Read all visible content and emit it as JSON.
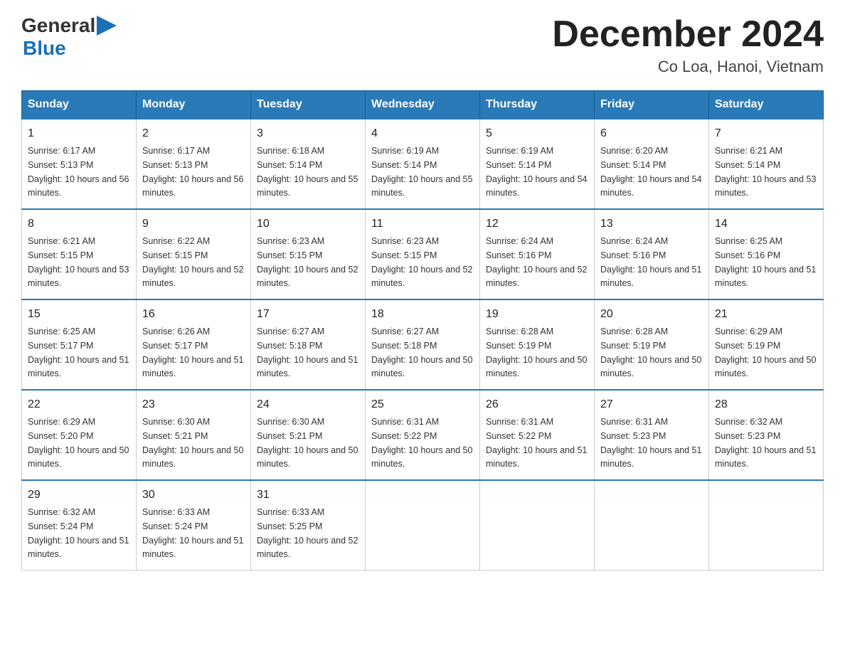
{
  "logo": {
    "text_general": "General",
    "text_blue": "Blue",
    "arrow_color": "#1a6fb5"
  },
  "title": "December 2024",
  "subtitle": "Co Loa, Hanoi, Vietnam",
  "days_of_week": [
    "Sunday",
    "Monday",
    "Tuesday",
    "Wednesday",
    "Thursday",
    "Friday",
    "Saturday"
  ],
  "weeks": [
    [
      {
        "day": "1",
        "sunrise": "6:17 AM",
        "sunset": "5:13 PM",
        "daylight": "10 hours and 56 minutes."
      },
      {
        "day": "2",
        "sunrise": "6:17 AM",
        "sunset": "5:13 PM",
        "daylight": "10 hours and 56 minutes."
      },
      {
        "day": "3",
        "sunrise": "6:18 AM",
        "sunset": "5:14 PM",
        "daylight": "10 hours and 55 minutes."
      },
      {
        "day": "4",
        "sunrise": "6:19 AM",
        "sunset": "5:14 PM",
        "daylight": "10 hours and 55 minutes."
      },
      {
        "day": "5",
        "sunrise": "6:19 AM",
        "sunset": "5:14 PM",
        "daylight": "10 hours and 54 minutes."
      },
      {
        "day": "6",
        "sunrise": "6:20 AM",
        "sunset": "5:14 PM",
        "daylight": "10 hours and 54 minutes."
      },
      {
        "day": "7",
        "sunrise": "6:21 AM",
        "sunset": "5:14 PM",
        "daylight": "10 hours and 53 minutes."
      }
    ],
    [
      {
        "day": "8",
        "sunrise": "6:21 AM",
        "sunset": "5:15 PM",
        "daylight": "10 hours and 53 minutes."
      },
      {
        "day": "9",
        "sunrise": "6:22 AM",
        "sunset": "5:15 PM",
        "daylight": "10 hours and 52 minutes."
      },
      {
        "day": "10",
        "sunrise": "6:23 AM",
        "sunset": "5:15 PM",
        "daylight": "10 hours and 52 minutes."
      },
      {
        "day": "11",
        "sunrise": "6:23 AM",
        "sunset": "5:15 PM",
        "daylight": "10 hours and 52 minutes."
      },
      {
        "day": "12",
        "sunrise": "6:24 AM",
        "sunset": "5:16 PM",
        "daylight": "10 hours and 52 minutes."
      },
      {
        "day": "13",
        "sunrise": "6:24 AM",
        "sunset": "5:16 PM",
        "daylight": "10 hours and 51 minutes."
      },
      {
        "day": "14",
        "sunrise": "6:25 AM",
        "sunset": "5:16 PM",
        "daylight": "10 hours and 51 minutes."
      }
    ],
    [
      {
        "day": "15",
        "sunrise": "6:25 AM",
        "sunset": "5:17 PM",
        "daylight": "10 hours and 51 minutes."
      },
      {
        "day": "16",
        "sunrise": "6:26 AM",
        "sunset": "5:17 PM",
        "daylight": "10 hours and 51 minutes."
      },
      {
        "day": "17",
        "sunrise": "6:27 AM",
        "sunset": "5:18 PM",
        "daylight": "10 hours and 51 minutes."
      },
      {
        "day": "18",
        "sunrise": "6:27 AM",
        "sunset": "5:18 PM",
        "daylight": "10 hours and 50 minutes."
      },
      {
        "day": "19",
        "sunrise": "6:28 AM",
        "sunset": "5:19 PM",
        "daylight": "10 hours and 50 minutes."
      },
      {
        "day": "20",
        "sunrise": "6:28 AM",
        "sunset": "5:19 PM",
        "daylight": "10 hours and 50 minutes."
      },
      {
        "day": "21",
        "sunrise": "6:29 AM",
        "sunset": "5:19 PM",
        "daylight": "10 hours and 50 minutes."
      }
    ],
    [
      {
        "day": "22",
        "sunrise": "6:29 AM",
        "sunset": "5:20 PM",
        "daylight": "10 hours and 50 minutes."
      },
      {
        "day": "23",
        "sunrise": "6:30 AM",
        "sunset": "5:21 PM",
        "daylight": "10 hours and 50 minutes."
      },
      {
        "day": "24",
        "sunrise": "6:30 AM",
        "sunset": "5:21 PM",
        "daylight": "10 hours and 50 minutes."
      },
      {
        "day": "25",
        "sunrise": "6:31 AM",
        "sunset": "5:22 PM",
        "daylight": "10 hours and 50 minutes."
      },
      {
        "day": "26",
        "sunrise": "6:31 AM",
        "sunset": "5:22 PM",
        "daylight": "10 hours and 51 minutes."
      },
      {
        "day": "27",
        "sunrise": "6:31 AM",
        "sunset": "5:23 PM",
        "daylight": "10 hours and 51 minutes."
      },
      {
        "day": "28",
        "sunrise": "6:32 AM",
        "sunset": "5:23 PM",
        "daylight": "10 hours and 51 minutes."
      }
    ],
    [
      {
        "day": "29",
        "sunrise": "6:32 AM",
        "sunset": "5:24 PM",
        "daylight": "10 hours and 51 minutes."
      },
      {
        "day": "30",
        "sunrise": "6:33 AM",
        "sunset": "5:24 PM",
        "daylight": "10 hours and 51 minutes."
      },
      {
        "day": "31",
        "sunrise": "6:33 AM",
        "sunset": "5:25 PM",
        "daylight": "10 hours and 52 minutes."
      },
      null,
      null,
      null,
      null
    ]
  ]
}
